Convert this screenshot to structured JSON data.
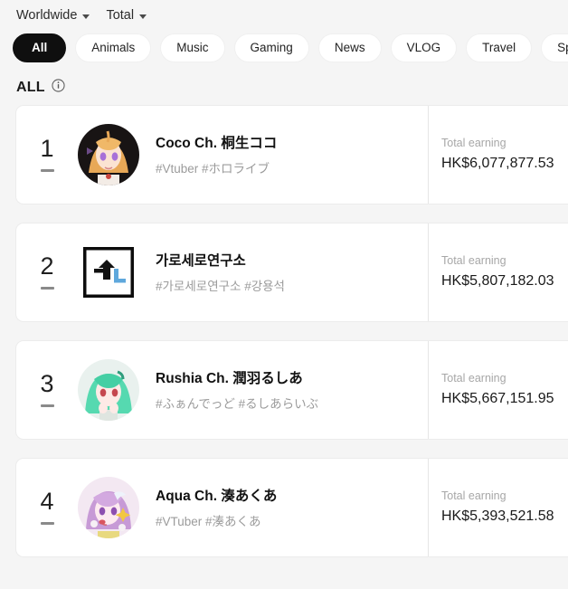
{
  "topbar": {
    "region_filter": "Worldwide",
    "metric_filter": "Total"
  },
  "categories": [
    {
      "label": "All",
      "active": true
    },
    {
      "label": "Animals",
      "active": false
    },
    {
      "label": "Music",
      "active": false
    },
    {
      "label": "Gaming",
      "active": false
    },
    {
      "label": "News",
      "active": false
    },
    {
      "label": "VLOG",
      "active": false
    },
    {
      "label": "Travel",
      "active": false
    },
    {
      "label": "Sports",
      "active": false
    },
    {
      "label": "",
      "active": false
    }
  ],
  "section": {
    "title": "ALL",
    "info_icon": "info-circle-icon"
  },
  "labels": {
    "total_earning": "Total earning"
  },
  "rows": [
    {
      "rank": "1",
      "trend": "no-change",
      "name": "Coco Ch. 桐生ココ",
      "tags": "#Vtuber #ホロライブ",
      "earning_label": "Total earning",
      "earning": "HK$6,077,877.53",
      "avatar_type": "photo",
      "avatar_name": "avatar-coco"
    },
    {
      "rank": "2",
      "trend": "no-change",
      "name": "가로세로연구소",
      "tags": "#가로세로연구소 #강용석",
      "earning_label": "Total earning",
      "earning": "HK$5,807,182.03",
      "avatar_type": "logo",
      "avatar_name": "logo-garosero"
    },
    {
      "rank": "3",
      "trend": "no-change",
      "name": "Rushia Ch. 潤羽るしあ",
      "tags": "#ふぁんでっど #るしあらいぶ",
      "earning_label": "Total earning",
      "earning": "HK$5,667,151.95",
      "avatar_type": "photo",
      "avatar_name": "avatar-rushia"
    },
    {
      "rank": "4",
      "trend": "no-change",
      "name": "Aqua Ch. 湊あくあ",
      "tags": "#VTuber #湊あくあ",
      "earning_label": "Total earning",
      "earning": "HK$5,393,521.58",
      "avatar_type": "photo",
      "avatar_name": "avatar-aqua"
    }
  ],
  "colors": {
    "page_background": "#f5f5f5",
    "card_background": "#ffffff",
    "active_chip": "#0f0f0f",
    "muted_text": "#9b9b9b",
    "logo_accent": "#5fa8dc"
  }
}
